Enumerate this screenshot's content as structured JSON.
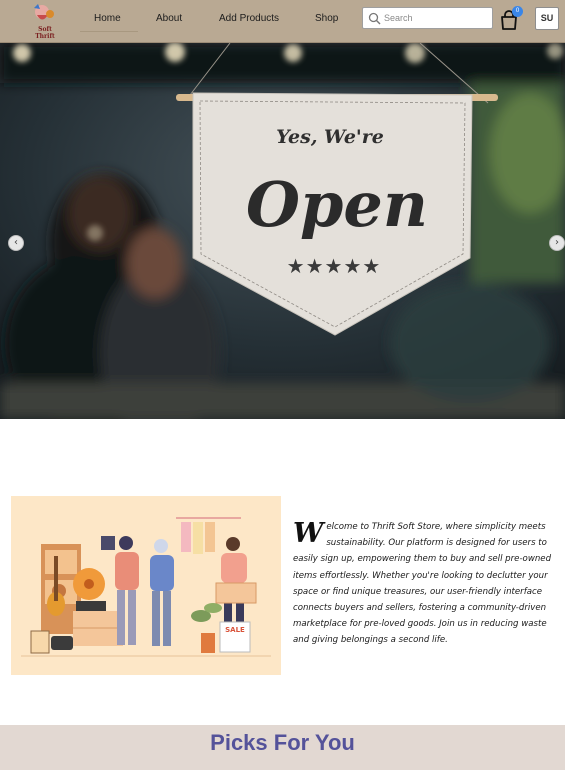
{
  "nav": {
    "logo_text": "Soft Thrift",
    "items": [
      {
        "label": "Home"
      },
      {
        "label": "About"
      },
      {
        "label": "Add Products"
      },
      {
        "label": "Shop"
      }
    ],
    "search_placeholder": "Search",
    "cart_count": "0",
    "user_initials": "SU"
  },
  "hero": {
    "sign_line1": "Yes, We're",
    "sign_line2": "Open",
    "sign_stars": "★★★★★",
    "prev_icon": "chevron-left-icon",
    "next_icon": "chevron-right-icon"
  },
  "about": {
    "dropcap": "W",
    "text": "elcome to Thrift Soft Store, where simplicity meets sustainability. Our platform is designed for users to easily sign up, empowering them to buy and sell pre-owned items effortlessly. Whether you're looking to declutter your space or find unique treasures, our user-friendly interface connects buyers and sellers, fostering a community-driven marketplace for pre-loved goods. Join us in reducing waste and giving belongings a second life.",
    "sale_sign": "SALE"
  },
  "picks": {
    "title": "Picks For You"
  },
  "colors": {
    "navbar": "#b9a993",
    "picks_bg": "#e2d8d2",
    "picks_title": "#54529a",
    "badge": "#3a86e8"
  }
}
